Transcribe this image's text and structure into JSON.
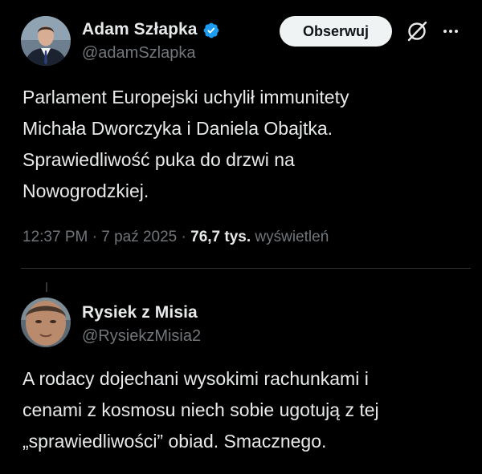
{
  "tweet": {
    "author": {
      "display_name": "Adam Szłapka",
      "handle": "@adamSzlapka",
      "verified": true
    },
    "follow_label": "Obserwuj",
    "text": "Parlament Europejski uchylił immunitety\nMichała Dworczyka i Daniela Obajtka.\nSprawiedliwość puka do drzwi na\nNowogrodzkiej.",
    "time": "12:37 PM",
    "separator": "·",
    "date": "7 paź 2025",
    "views_count": "76,7 tys.",
    "views_label": "wyświetleń"
  },
  "reply": {
    "author": {
      "display_name": "Rysiek z Misia",
      "handle": "@RysiekzMisia2"
    },
    "text": "A rodacy dojechani wysokimi rachunkami i\ncenami z kosmosu niech sobie ugotują z tej\n„sprawiedliwości” obiad. Smacznego."
  },
  "colors": {
    "background": "#000000",
    "text_primary": "#e7e9ea",
    "text_secondary": "#71767b",
    "verified_badge": "#1d9bf0",
    "follow_button_bg": "#eff3f4",
    "divider": "#2f3336"
  },
  "icons": {
    "verified": "verified-badge-icon",
    "grok": "grok-icon",
    "more": "more-options-icon"
  }
}
